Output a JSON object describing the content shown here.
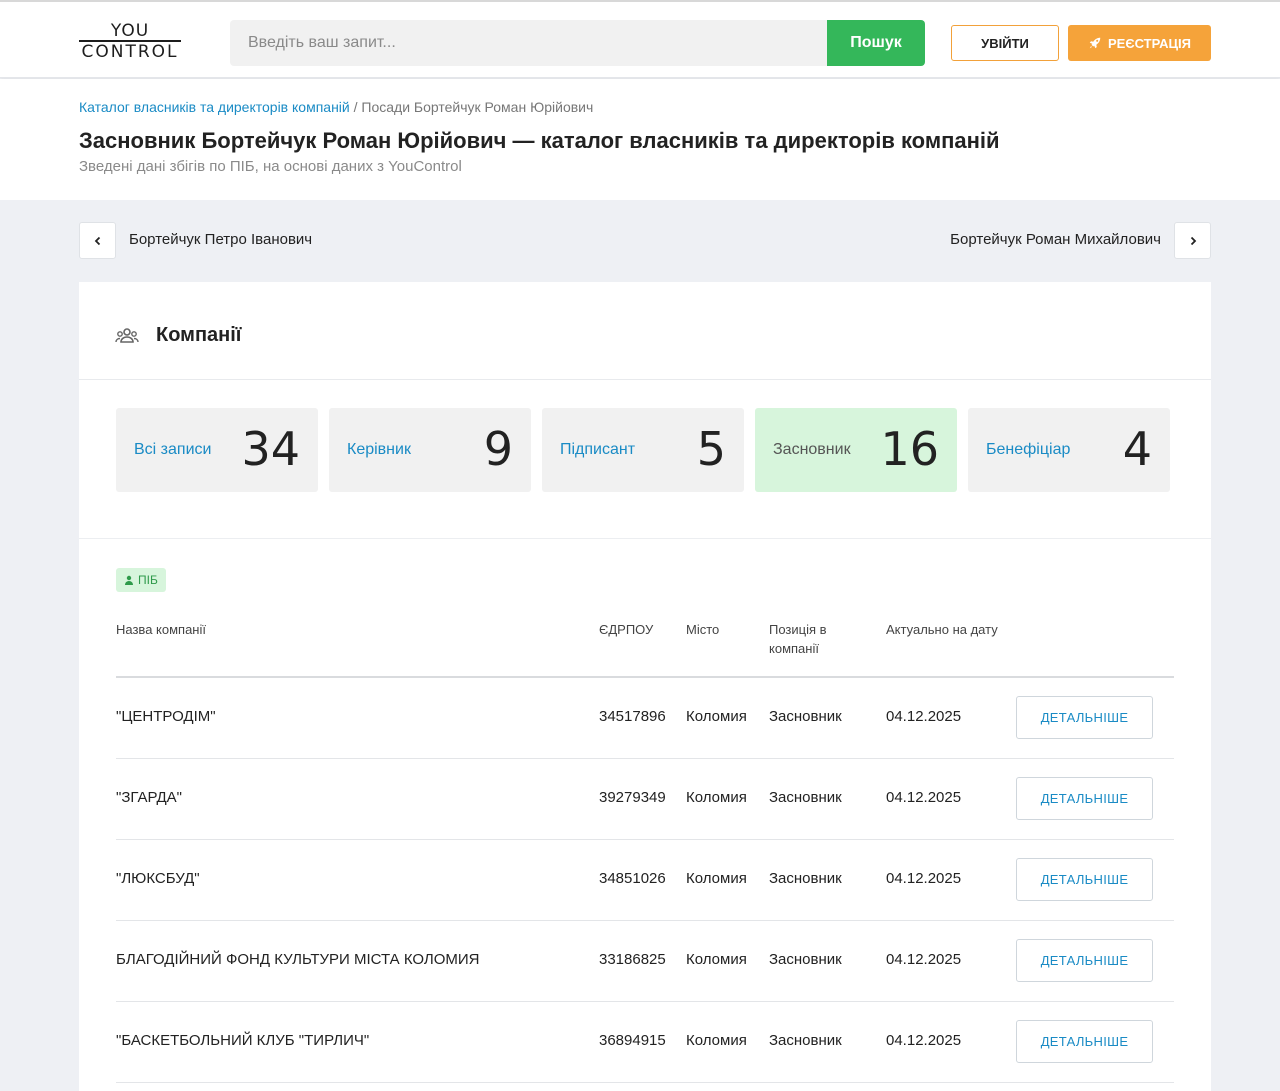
{
  "header": {
    "logo_line1": "YOU",
    "logo_line2": "CONTROL",
    "search_placeholder": "Введіть ваш запит...",
    "search_button": "Пошук",
    "login_button": "УВІЙТИ",
    "register_button": "РЕЄСТРАЦІЯ"
  },
  "breadcrumb": {
    "link": "Каталог власників та директорів компаній",
    "separator": " / ",
    "current": "Посади Бортейчук Роман Юрійович"
  },
  "page": {
    "title": "Засновник Бортейчук Роман Юрійович — каталог власників та директорів компаній",
    "subtitle": "Зведені дані збігів по ПІБ, на основі даних з YouControl"
  },
  "pager": {
    "prev_name": "Бортейчук Петро Іванович",
    "next_name": "Бортейчук Роман Михайлович"
  },
  "companies": {
    "title": "Компанії",
    "tiles": [
      {
        "label": "Всі записи",
        "count": "34",
        "active": false
      },
      {
        "label": "Керівник",
        "count": "9",
        "active": false
      },
      {
        "label": "Підписант",
        "count": "5",
        "active": false
      },
      {
        "label": "Засновник",
        "count": "16",
        "active": true
      },
      {
        "label": "Бенефіціар",
        "count": "4",
        "active": false
      }
    ],
    "badge": "ПІБ",
    "columns": {
      "name": "Назва компанії",
      "code": "ЄДРПОУ",
      "city": "Місто",
      "position_line1": "Позиція в",
      "position_line2": "компанії",
      "date": "Актуально на дату"
    },
    "detail_label": "ДЕТАЛЬНІШЕ",
    "rows": [
      {
        "name": "\"ЦЕНТРОДІМ\"",
        "code": "34517896",
        "city": "Коломия",
        "position": "Засновник",
        "date": "04.12.2025"
      },
      {
        "name": "\"ЗГАРДА\"",
        "code": "39279349",
        "city": "Коломия",
        "position": "Засновник",
        "date": "04.12.2025"
      },
      {
        "name": "\"ЛЮКСБУД\"",
        "code": "34851026",
        "city": "Коломия",
        "position": "Засновник",
        "date": "04.12.2025"
      },
      {
        "name": "БЛАГОДІЙНИЙ ФОНД КУЛЬТУРИ МІСТА КОЛОМИЯ",
        "code": "33186825",
        "city": "Коломия",
        "position": "Засновник",
        "date": "04.12.2025"
      },
      {
        "name": "\"БАСКЕТБОЛЬНИЙ КЛУБ \"ТИРЛИЧ\"",
        "code": "36894915",
        "city": "Коломия",
        "position": "Засновник",
        "date": "04.12.2025"
      }
    ]
  }
}
